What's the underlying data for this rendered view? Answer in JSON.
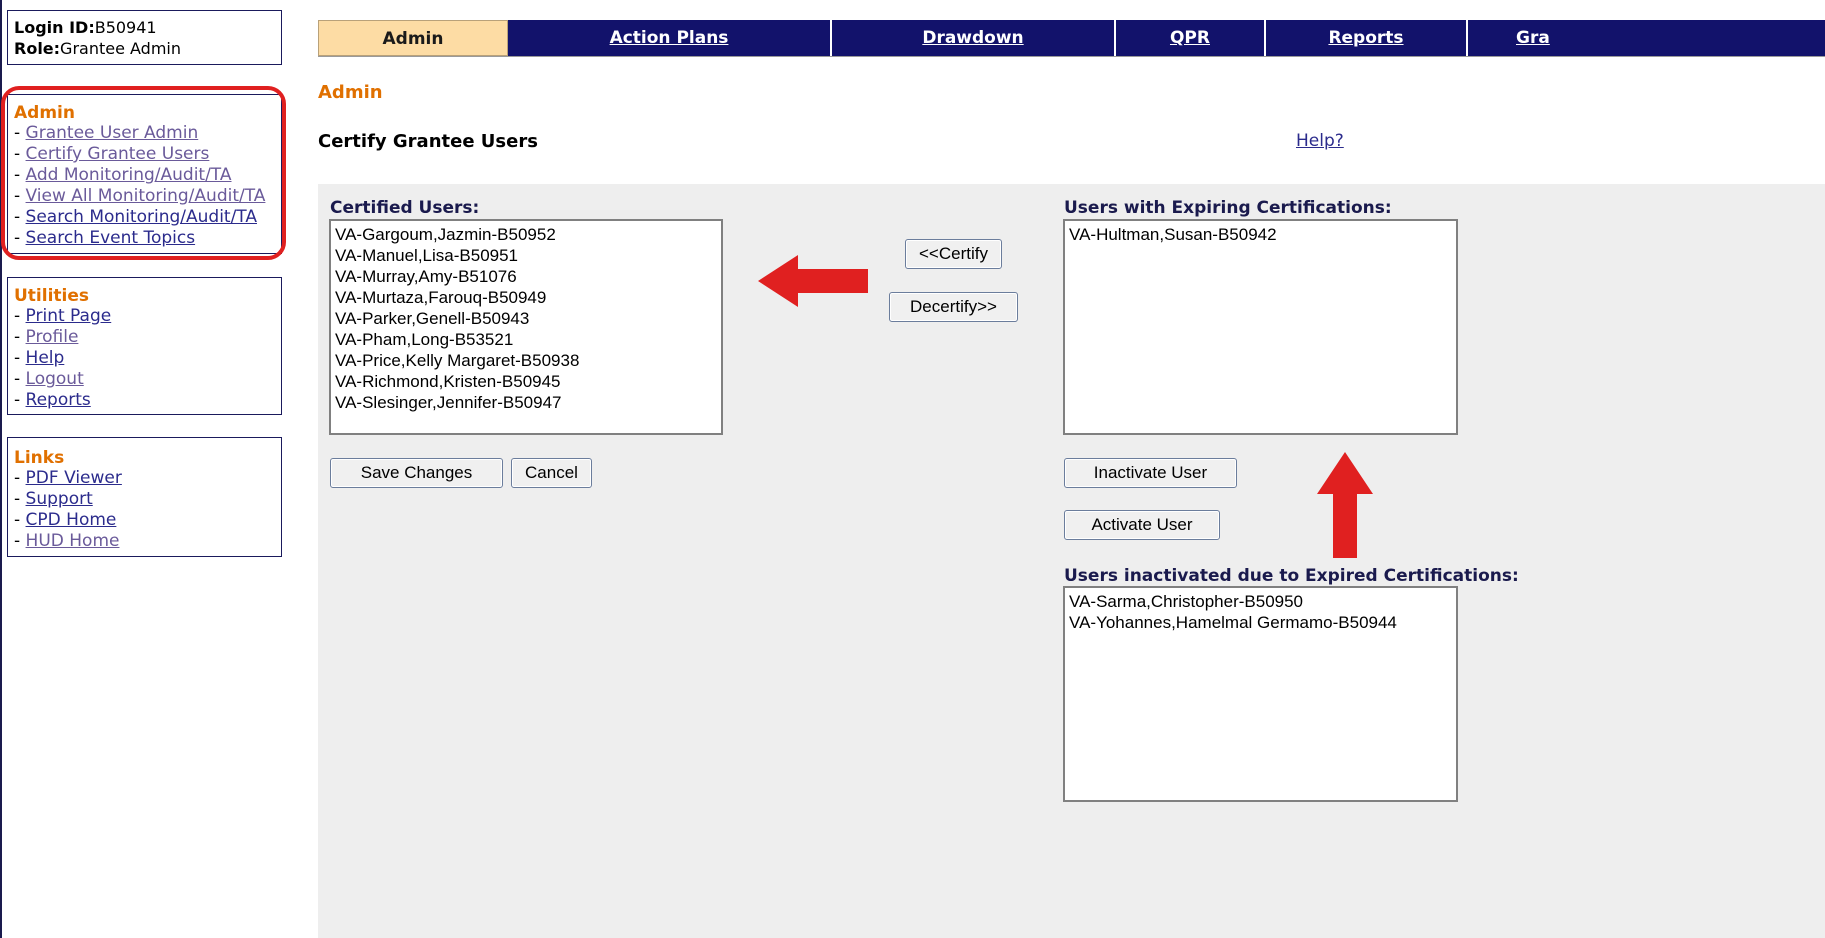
{
  "login": {
    "id_label": "Login ID:",
    "id_value": "B50941",
    "role_label": "Role:",
    "role_value": "Grantee Admin"
  },
  "sidebar": {
    "admin": {
      "heading": "Admin",
      "items": [
        "Grantee User Admin",
        "Certify Grantee Users",
        "Add Monitoring/Audit/TA",
        "View All Monitoring/Audit/TA",
        "Search Monitoring/Audit/TA",
        "Search Event Topics"
      ]
    },
    "utilities": {
      "heading": "Utilities",
      "items": [
        "Print Page",
        "Profile",
        "Help",
        "Logout",
        "Reports"
      ]
    },
    "links": {
      "heading": "Links",
      "items": [
        "PDF Viewer",
        "Support",
        "CPD Home",
        "HUD Home"
      ]
    }
  },
  "nav": {
    "tabs": [
      "Admin",
      "Action Plans",
      "Drawdown",
      "QPR",
      "Reports",
      "Gra"
    ]
  },
  "page": {
    "title": "Admin",
    "section": "Certify Grantee Users",
    "help": "Help?"
  },
  "certified": {
    "label": "Certified Users:",
    "users": [
      "VA-Gargoum,Jazmin-B50952",
      "VA-Manuel,Lisa-B50951",
      "VA-Murray,Amy-B51076",
      "VA-Murtaza,Farouq-B50949",
      "VA-Parker,Genell-B50943",
      "VA-Pham,Long-B53521",
      "VA-Price,Kelly Margaret-B50938",
      "VA-Richmond,Kristen-B50945",
      "VA-Slesinger,Jennifer-B50947"
    ]
  },
  "expiring": {
    "label": "Users with Expiring Certifications:",
    "users": [
      "VA-Hultman,Susan-B50942"
    ]
  },
  "inactivated": {
    "label": "Users inactivated due to Expired Certifications:",
    "users": [
      "VA-Sarma,Christopher-B50950",
      "VA-Yohannes,Hamelmal Germamo-B50944"
    ]
  },
  "buttons": {
    "certify": "<<Certify",
    "decertify": "Decertify>>",
    "save": "Save Changes",
    "cancel": "Cancel",
    "inactivate": "Inactivate User",
    "activate": "Activate User"
  },
  "colors": {
    "accent": "#e07000",
    "nav": "#12126b",
    "active_tab": "#fddca4",
    "annotation": "#e02020"
  }
}
